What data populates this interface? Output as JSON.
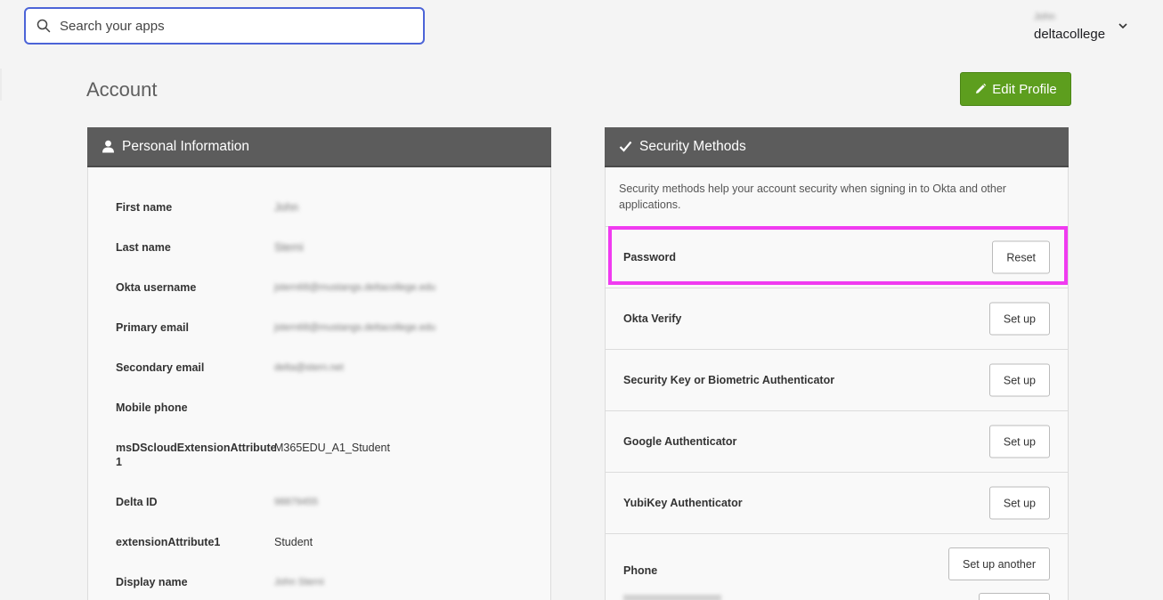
{
  "search": {
    "placeholder": "Search your apps"
  },
  "user": {
    "first_name": "John",
    "org": "deltacollege"
  },
  "page": {
    "title": "Account",
    "edit_profile_label": "Edit Profile"
  },
  "personal_info": {
    "title": "Personal Information",
    "rows": [
      {
        "label": "First name",
        "value": "John",
        "blurred": true
      },
      {
        "label": "Last name",
        "value": "Sterni",
        "blurred": true
      },
      {
        "label": "Okta username",
        "value": "jstern68@mustangs.deltacollege.edu",
        "blurred": true
      },
      {
        "label": "Primary email",
        "value": "jstern68@mustangs.deltacollege.edu",
        "blurred": true
      },
      {
        "label": "Secondary email",
        "value": "delta@stern.net",
        "blurred": true
      },
      {
        "label": "Mobile phone",
        "value": "",
        "blurred": false
      },
      {
        "label": "msDScloudExtensionAttribute 1",
        "value": "M365EDU_A1_Student",
        "blurred": false
      },
      {
        "label": "Delta ID",
        "value": "98879455",
        "blurred": true
      },
      {
        "label": "extensionAttribute1",
        "value": "Student",
        "blurred": false
      },
      {
        "label": "Display name",
        "value": "John Sterni",
        "blurred": true
      }
    ]
  },
  "security": {
    "title": "Security Methods",
    "description": "Security methods help your account security when signing in to Okta and other applications.",
    "methods": [
      {
        "label": "Password",
        "button": "Reset"
      },
      {
        "label": "Okta Verify",
        "button": "Set up"
      },
      {
        "label": "Security Key or Biometric Authenticator",
        "button": "Set up"
      },
      {
        "label": "Google Authenticator",
        "button": "Set up"
      },
      {
        "label": "YubiKey Authenticator",
        "button": "Set up"
      },
      {
        "label": "Phone",
        "button": "Set up another"
      }
    ]
  },
  "colors": {
    "accent": "#4c64d7",
    "edit_button": "#5d9e1e",
    "panel_header": "#5c5c5c",
    "highlight": "#f03bf0"
  },
  "icons": {
    "search": "search-icon",
    "chevron": "chevron-down-icon",
    "edit": "pencil-icon",
    "person": "person-icon",
    "check": "checkmark-icon"
  }
}
